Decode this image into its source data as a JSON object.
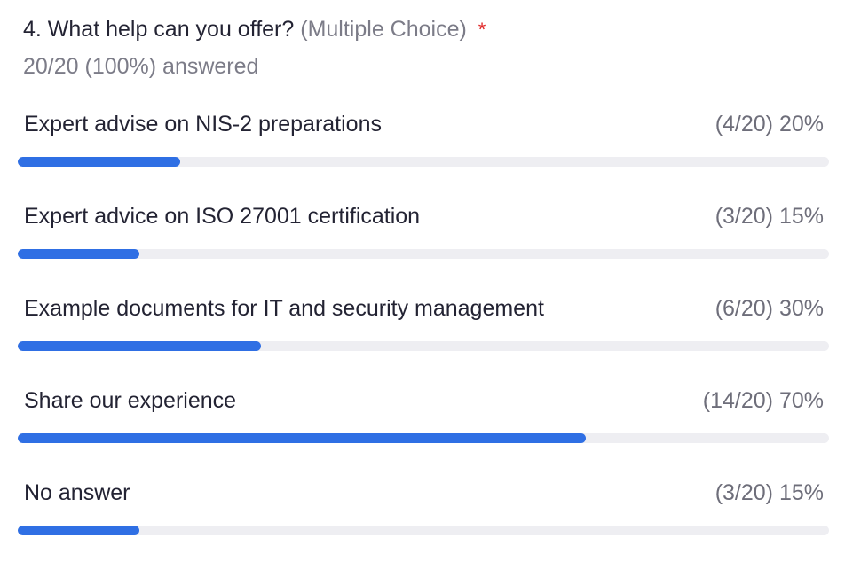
{
  "question": {
    "title": "4. What help can you offer?",
    "type_label": "(Multiple Choice)",
    "required_marker": "*",
    "answered": "20/20 (100%) answered"
  },
  "colors": {
    "bar_fill": "#2f6fe4",
    "bar_track": "#eeeef2",
    "required": "#e02828"
  },
  "options": [
    {
      "label": "Expert advise on NIS-2 preparations",
      "stat": "(4/20) 20%",
      "fraction": 0.2
    },
    {
      "label": "Expert advice on ISO 27001 certification",
      "stat": "(3/20) 15%",
      "fraction": 0.15
    },
    {
      "label": "Example documents for IT and security management",
      "stat": "(6/20) 30%",
      "fraction": 0.3
    },
    {
      "label": "Share our experience",
      "stat": "(14/20) 70%",
      "fraction": 0.7
    },
    {
      "label": "No answer",
      "stat": "(3/20) 15%",
      "fraction": 0.15
    }
  ]
}
